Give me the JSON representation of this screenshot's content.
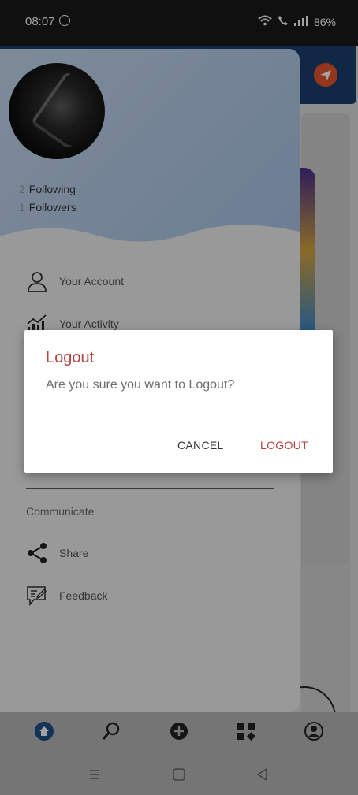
{
  "status_bar": {
    "time": "08:07",
    "battery": "86%"
  },
  "profile": {
    "following_count": "2",
    "following_label": "Following",
    "followers_count": "1",
    "followers_label": "Followers"
  },
  "drawer": {
    "items": [
      {
        "label": "Your Account",
        "icon": "user-icon"
      },
      {
        "label": "Your Activity",
        "icon": "activity-chart-icon"
      }
    ],
    "communicate_title": "Communicate",
    "communicate_items": [
      {
        "label": "Share",
        "icon": "share-icon"
      },
      {
        "label": "Feedback",
        "icon": "feedback-icon"
      }
    ]
  },
  "dialog": {
    "title": "Logout",
    "message": "Are you sure you want to Logout?",
    "cancel_label": "CANCEL",
    "confirm_label": "LOGOUT"
  },
  "bottom_nav": [
    "home-icon",
    "search-icon",
    "add-icon",
    "grid-icon",
    "profile-icon"
  ],
  "colors": {
    "accent": "#b4443e",
    "header_blue": "#1b3e6e",
    "nav_active": "#1f4f8a"
  }
}
